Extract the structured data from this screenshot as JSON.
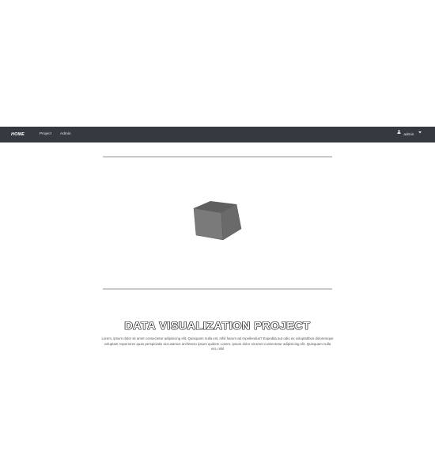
{
  "navbar": {
    "brand": "HOME",
    "links": [
      "Project",
      "Admin"
    ],
    "user": {
      "icon": "user-icon",
      "label": "admin",
      "dropdown_icon": "caret-down-icon"
    }
  },
  "hero": {
    "graphic": "rotating-cube",
    "title": "DATA VISUALIZATION PROJECT",
    "description": "Lorem, ipsum dolor sit amet consectetur adipisicing elit. Quisquam nulla est, nihil harum ad repellendus? Expedita aut odio ex voluptatibus doloremque voluptas! Asperiores quas perspiciatis accusamus architecto ipsum quidem Lorem, ipsum dolor sit amet consectetur adipisicing elit. Quisquam nulla est, nihil"
  },
  "colors": {
    "navbar_bg": "#343a40",
    "divider": "#c9c9c9",
    "cube_top": "#5f5f5f",
    "cube_left": "#7a7a7a",
    "cube_right": "#6a6a6a"
  }
}
